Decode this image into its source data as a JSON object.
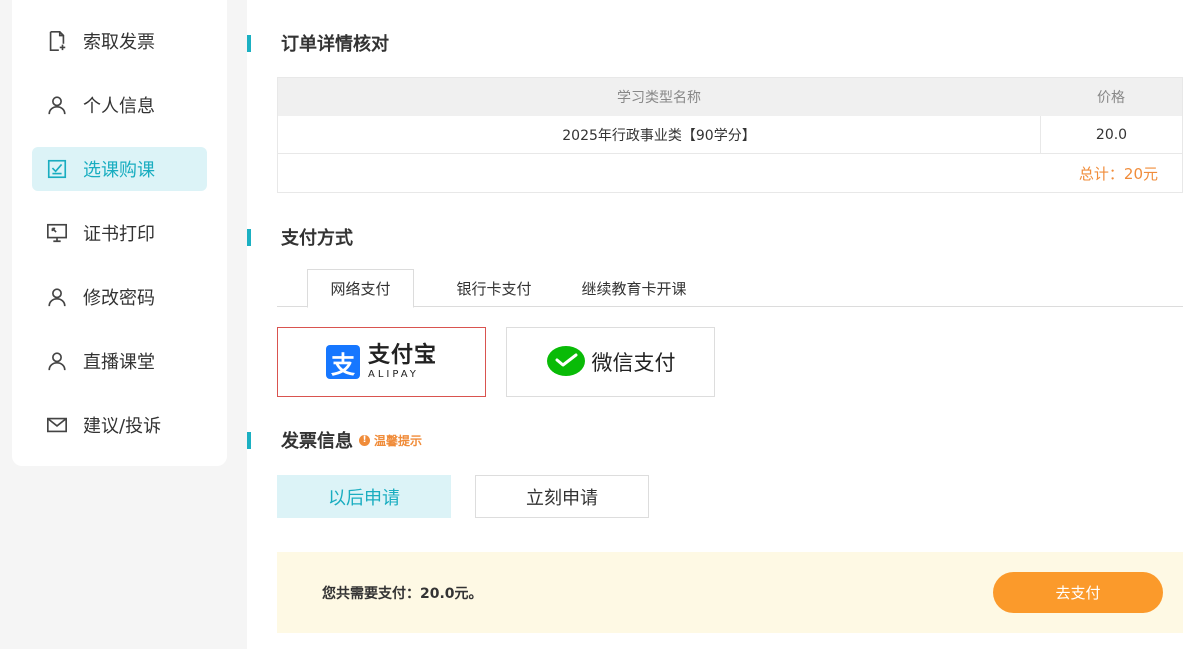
{
  "sidebar": {
    "items": [
      {
        "label": "索取发票",
        "icon": "invoice-icon"
      },
      {
        "label": "个人信息",
        "icon": "user-icon"
      },
      {
        "label": "选课购课",
        "icon": "checkbox-icon",
        "active": true
      },
      {
        "label": "证书打印",
        "icon": "monitor-icon"
      },
      {
        "label": "修改密码",
        "icon": "user-icon"
      },
      {
        "label": "直播课堂",
        "icon": "user-icon"
      },
      {
        "label": "建议/投诉",
        "icon": "mail-icon"
      }
    ]
  },
  "order": {
    "title": "订单详情核对",
    "columns": [
      "学习类型名称",
      "价格"
    ],
    "rows": [
      [
        "2025年行政事业类【90学分】",
        "20.0"
      ]
    ],
    "total": "总计：20元"
  },
  "payment": {
    "title": "支付方式",
    "tabs": [
      "网络支付",
      "银行卡支付",
      "继续教育卡开课"
    ],
    "alipay_cn": "支付宝",
    "alipay_en": "ALIPAY",
    "wechat": "微信支付"
  },
  "invoice": {
    "title": "发票信息",
    "tip": "温馨提示",
    "later": "以后申请",
    "now": "立刻申请"
  },
  "paybar": {
    "amount_text": "您共需要支付：20.0元。",
    "button": "去支付"
  },
  "colors": {
    "accent": "#19adc0",
    "orange": "#fb9a2b",
    "alipay": "#1677ff",
    "wechat": "#09bb07"
  }
}
